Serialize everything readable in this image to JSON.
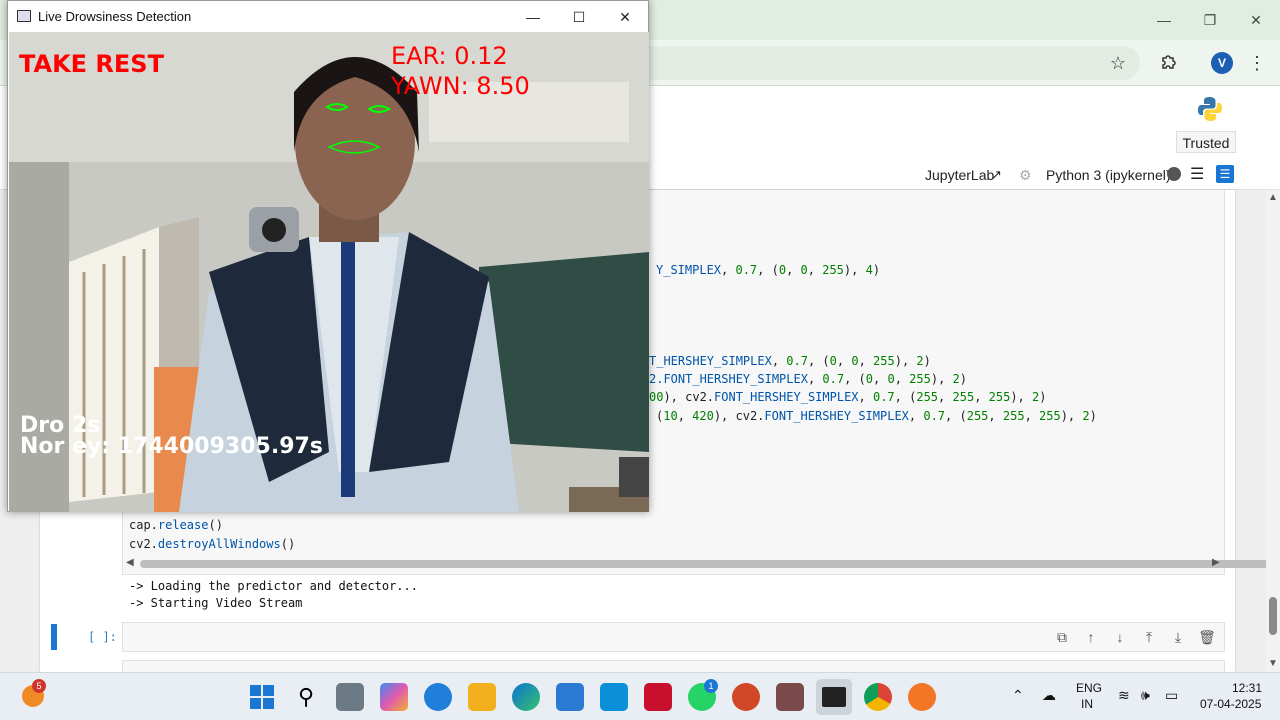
{
  "browser": {
    "window_controls": {
      "minimize": "—",
      "restore": "❐",
      "close": "✕"
    },
    "account_initial": "V",
    "icons": [
      "star-icon",
      "extensions-icon",
      "menu-icon"
    ]
  },
  "jupyter": {
    "trusted_label": "Trusted",
    "jupyterlab_label": "JupyterLab",
    "kernel_label": "Python 3 (ipykernel)"
  },
  "code_lines": {
    "l1": [
      "Y_SIMPLEX",
      ", ",
      "0.7",
      ", (",
      "0",
      ", ",
      "0",
      ", ",
      "255",
      "), ",
      "4",
      ")"
    ],
    "l2": [
      "T_HERSHEY_SIMPLEX",
      ", ",
      "0.7",
      ", (",
      "0",
      ", ",
      "0",
      ", ",
      "255",
      "), ",
      "2",
      ")"
    ],
    "l3": [
      "2.FONT_HERSHEY_SIMPLEX",
      ", ",
      "0.7",
      ", (",
      "0",
      ", ",
      "0",
      ", ",
      "255",
      "), ",
      "2",
      ")"
    ],
    "l4": [
      "00",
      "), cv2.",
      "FONT_HERSHEY_SIMPLEX",
      ", ",
      "0.7",
      ", (",
      "255",
      ", ",
      "255",
      ", ",
      "255",
      "), ",
      "2",
      ")"
    ],
    "l5": [
      "(",
      "10",
      ", ",
      "420",
      "), cv2.",
      "FONT_HERSHEY_SIMPLEX",
      ", ",
      "0.7",
      ", (",
      "255",
      ", ",
      "255",
      ", ",
      "255",
      "), ",
      "2",
      ")"
    ],
    "release": [
      "cap.",
      "release",
      "()"
    ],
    "destroy": [
      "cv2.",
      "destroyAllWindows",
      "()"
    ]
  },
  "output": {
    "line1": "-> Loading the predictor and detector...",
    "line2": "-> Starting Video Stream"
  },
  "empty_prompt": "[ ]:",
  "cv_window": {
    "title": "Live Drowsiness Detection",
    "overlay": {
      "alert": "TAKE REST",
      "ear": "EAR: 0.12",
      "yawn": "YAWN: 8.50",
      "drowsy_line": "Dro       2s",
      "normal_line": "Nor       ey: 1744009305.97s"
    }
  },
  "taskbar": {
    "notification_count": "5",
    "whatsapp_badge": "1",
    "lang_top": "ENG",
    "lang_bottom": "IN",
    "time": "12:31",
    "date": "07-04-2025"
  }
}
